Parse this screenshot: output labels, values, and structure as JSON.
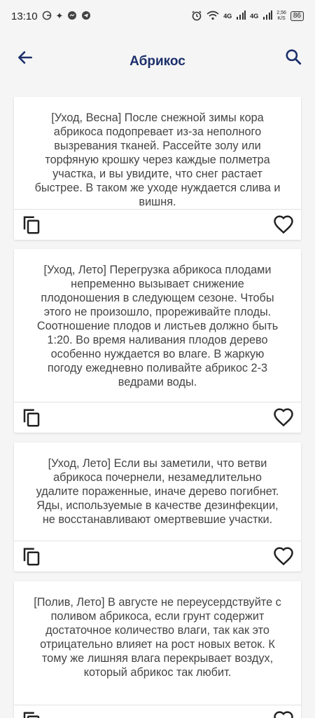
{
  "status_bar": {
    "time": "13:10",
    "net1": "4G",
    "net2": "4G",
    "speed_value": "2,56",
    "speed_unit": "K/S",
    "battery": "86"
  },
  "app_bar": {
    "title": "Абрикос"
  },
  "cards": [
    {
      "text": "[Уход, Весна] После снежной зимы кора абрикоса подопревает из-за неполного вызревания тканей. Рассейте золу или торфяную крошку через каждые полметра участка, и вы увидите, что снег растает быстрее. В таком же уходе нуждается слива и вишня."
    },
    {
      "text": "[Уход, Лето] Перегрузка абрикоса плодами непременно вызывает снижение плодоношения в следующем сезоне. Чтобы этого не произошло, прореживайте плоды. Соотношение плодов и листьев должно быть 1:20. Во время наливания плодов дерево особенно нуждается во влаге. В жаркую погоду ежедневно поливайте абрикос 2-3 ведрами воды."
    },
    {
      "text": "[Уход, Лето] Если вы заметили, что ветви абрикоса почернели, незамедлительно удалите пораженные, иначе дерево погибнет. Яды, используемые в качестве дезинфекции, не восстанавливают омертвевшие участки."
    },
    {
      "text": "[Полив, Лето] В августе не переусердствуйте с поливом абрикоса, если грунт содержит достаточное количество влаги, так как это отрицательно влияет на рост новых веток. К тому же лишняя влага перекрывает воздух, который абрикос так любит."
    }
  ],
  "colors": {
    "accent": "#1c2f6b",
    "background": "#f5f5f5",
    "card": "#ffffff"
  }
}
